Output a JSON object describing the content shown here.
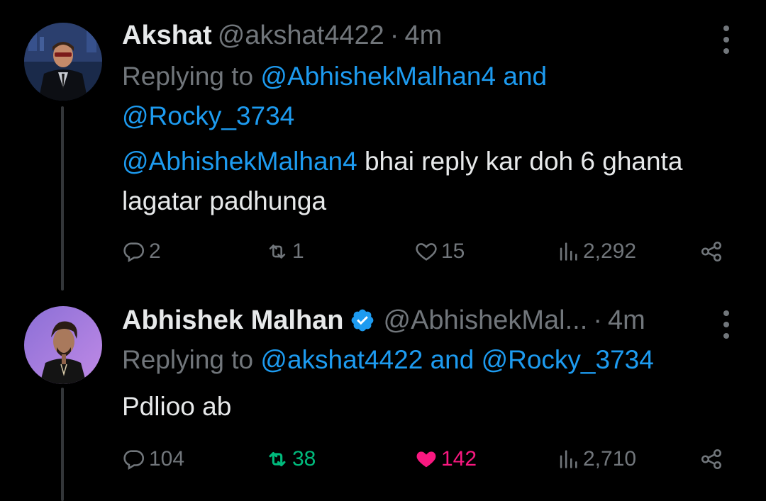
{
  "colors": {
    "background": "#000000",
    "text": "#e7e9ea",
    "secondary": "#71767b",
    "link": "#1d9bf0",
    "retweet_active": "#00ba7c",
    "like_active": "#f91880",
    "verified": "#1d9bf0"
  },
  "tweets": [
    {
      "name": "Akshat",
      "handle": "@akshat4422",
      "separator": "·",
      "time": "4m",
      "replying_prefix": "Replying to",
      "replying_mention_1": "@AbhishekMalhan4",
      "replying_and": "and",
      "replying_mention_2": "@Rocky_3734",
      "body_mention": "@AbhishekMalhan4",
      "body_text": "bhai reply kar doh 6 ghanta lagatar padhunga",
      "replies": "2",
      "retweets": "1",
      "likes": "15",
      "views": "2,292",
      "retweeted": false,
      "liked": false,
      "verified": false
    },
    {
      "name": "Abhishek Malhan",
      "handle": "@AbhishekMal...",
      "separator": "·",
      "time": "4m",
      "replying_prefix": "Replying to",
      "replying_mention_1": "@akshat4422",
      "replying_and": "and",
      "replying_mention_2": "@Rocky_3734",
      "body_text": "Pdlioo ab",
      "replies": "104",
      "retweets": "38",
      "likes": "142",
      "views": "2,710",
      "retweeted": true,
      "liked": true,
      "verified": true
    }
  ],
  "icons": {
    "reply": "reply-icon",
    "retweet": "retweet-icon",
    "like": "heart-icon",
    "views": "views-icon",
    "share": "share-icon",
    "more": "more-icon",
    "verified": "verified-badge-icon"
  }
}
